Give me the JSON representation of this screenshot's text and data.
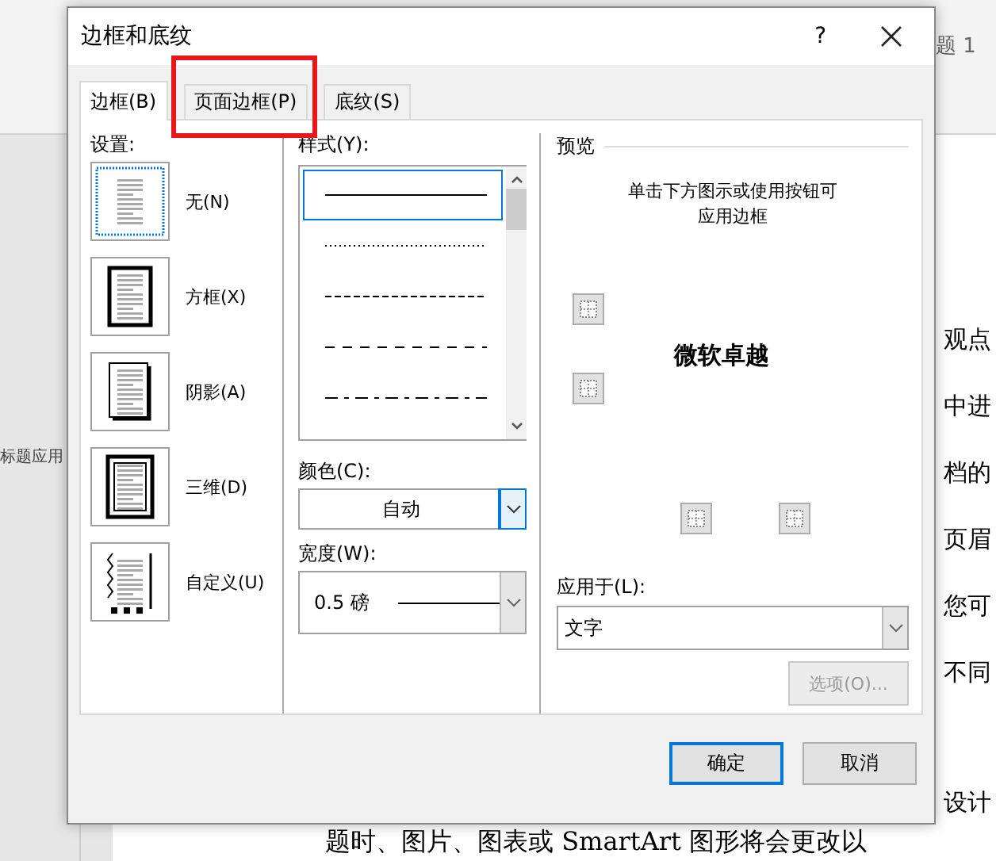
{
  "background": {
    "style_caption": "题 1",
    "nav_pane_text": "标题应用",
    "document_lines": [
      "观点",
      "中进",
      "档的",
      "页眉",
      "您可",
      "不同",
      "设计"
    ],
    "document_bottom_line": "题时、图片、图表或 SmartArt 图形将会更改以"
  },
  "dialog": {
    "title": "边框和底纹",
    "help": "?",
    "tabs": [
      {
        "label": "边框(B)",
        "selected": true,
        "highlighted": false
      },
      {
        "label": "页面边框(P)",
        "selected": false,
        "highlighted": true
      },
      {
        "label": "底纹(S)",
        "selected": false,
        "highlighted": false
      }
    ],
    "settings": {
      "label": "设置:",
      "items": [
        {
          "label": "无(N)",
          "kind": "none",
          "selected": true
        },
        {
          "label": "方框(X)",
          "kind": "box",
          "selected": false
        },
        {
          "label": "阴影(A)",
          "kind": "shadow",
          "selected": false
        },
        {
          "label": "三维(D)",
          "kind": "threed",
          "selected": false
        },
        {
          "label": "自定义(U)",
          "kind": "custom",
          "selected": false
        }
      ]
    },
    "style": {
      "label": "样式(Y):",
      "lines": [
        {
          "kind": "solid",
          "selected": true
        },
        {
          "kind": "dotted",
          "selected": false
        },
        {
          "kind": "dashed",
          "selected": false
        },
        {
          "kind": "long-dash",
          "selected": false
        },
        {
          "kind": "dash-dot",
          "selected": false
        }
      ]
    },
    "color": {
      "label": "颜色(C):",
      "value": "自动"
    },
    "width": {
      "label": "宽度(W):",
      "value": "0.5 磅"
    },
    "preview": {
      "label": "预览",
      "hint": "单击下方图示或使用按钮可应用边框",
      "sample_text": "微软卓越"
    },
    "apply_to": {
      "label": "应用于(L):",
      "value": "文字"
    },
    "options_button": {
      "label": "选项(O)...",
      "disabled": true
    },
    "buttons": [
      {
        "label": "确定",
        "default": true
      },
      {
        "label": "取消",
        "default": false
      }
    ]
  }
}
